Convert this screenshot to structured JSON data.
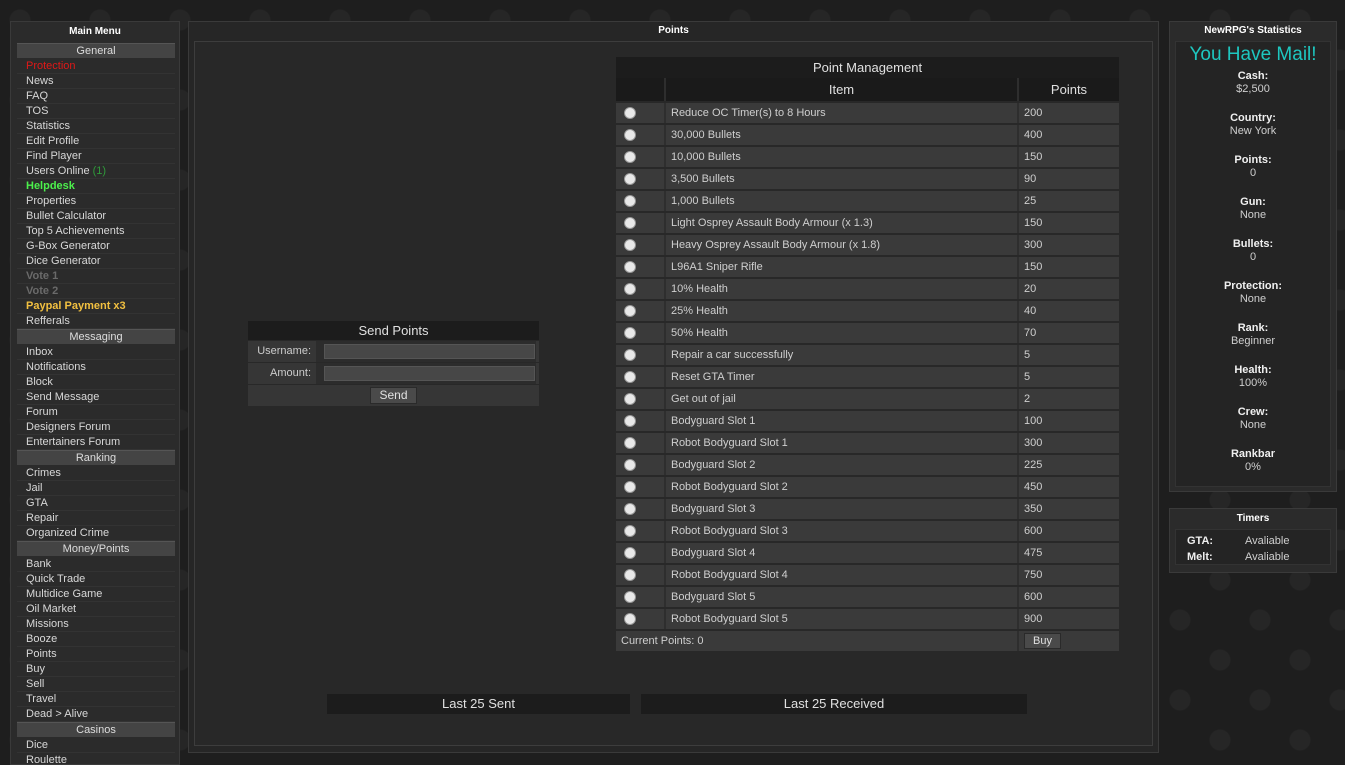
{
  "main_menu": {
    "title": "Main Menu",
    "sections": [
      {
        "name": "General",
        "items": [
          {
            "label": "Protection",
            "color": "#e01818",
            "bold": false
          },
          {
            "label": "News"
          },
          {
            "label": "FAQ"
          },
          {
            "label": "TOS"
          },
          {
            "label": "Statistics"
          },
          {
            "label": "Edit Profile"
          },
          {
            "label": "Find Player"
          },
          {
            "label": "Users Online",
            "count": "(1)"
          },
          {
            "label": "Helpdesk",
            "color": "#4cf04c",
            "bold": true
          },
          {
            "label": "Properties"
          },
          {
            "label": "Bullet Calculator"
          },
          {
            "label": "Top 5 Achievements"
          },
          {
            "label": "G-Box Generator"
          },
          {
            "label": "Dice Generator"
          },
          {
            "label": "Vote 1",
            "color": "#6a6a6a",
            "bold": true
          },
          {
            "label": "Vote 2",
            "color": "#6a6a6a",
            "bold": true
          },
          {
            "label": "Paypal Payment x3",
            "color": "#f2c040",
            "bold": true
          },
          {
            "label": "Refferals"
          }
        ]
      },
      {
        "name": "Messaging",
        "items": [
          {
            "label": "Inbox"
          },
          {
            "label": "Notifications"
          },
          {
            "label": "Block"
          },
          {
            "label": "Send Message"
          },
          {
            "label": "Forum"
          },
          {
            "label": "Designers Forum"
          },
          {
            "label": "Entertainers Forum"
          }
        ]
      },
      {
        "name": "Ranking",
        "items": [
          {
            "label": "Crimes"
          },
          {
            "label": "Jail"
          },
          {
            "label": "GTA"
          },
          {
            "label": "Repair"
          },
          {
            "label": "Organized Crime"
          }
        ]
      },
      {
        "name": "Money/Points",
        "items": [
          {
            "label": "Bank"
          },
          {
            "label": "Quick Trade"
          },
          {
            "label": "Multidice Game"
          },
          {
            "label": "Oil Market"
          },
          {
            "label": "Missions"
          },
          {
            "label": "Booze"
          },
          {
            "label": "Points"
          },
          {
            "label": "Buy"
          },
          {
            "label": "Sell"
          },
          {
            "label": "Travel"
          },
          {
            "label": "Dead > Alive"
          }
        ]
      },
      {
        "name": "Casinos",
        "items": [
          {
            "label": "Dice"
          },
          {
            "label": "Roulette"
          }
        ]
      }
    ]
  },
  "center": {
    "title": "Points",
    "send_points": {
      "title": "Send Points",
      "username_label": "Username:",
      "username_value": "",
      "amount_label": "Amount:",
      "amount_value": "",
      "send_label": "Send"
    },
    "point_management": {
      "title": "Point Management",
      "col_item": "Item",
      "col_points": "Points",
      "rows": [
        {
          "item": "Reduce OC Timer(s) to 8 Hours",
          "points": "200"
        },
        {
          "item": "30,000 Bullets",
          "points": "400"
        },
        {
          "item": "10,000 Bullets",
          "points": "150"
        },
        {
          "item": "3,500 Bullets",
          "points": "90"
        },
        {
          "item": "1,000 Bullets",
          "points": "25"
        },
        {
          "item": "Light Osprey Assault Body Armour (x 1.3)",
          "points": "150"
        },
        {
          "item": "Heavy Osprey Assault Body Armour (x 1.8)",
          "points": "300"
        },
        {
          "item": "L96A1 Sniper Rifle",
          "points": "150"
        },
        {
          "item": "10% Health",
          "points": "20"
        },
        {
          "item": "25% Health",
          "points": "40"
        },
        {
          "item": "50% Health",
          "points": "70"
        },
        {
          "item": "Repair a car successfully",
          "points": "5"
        },
        {
          "item": "Reset GTA Timer",
          "points": "5"
        },
        {
          "item": "Get out of jail",
          "points": "2"
        },
        {
          "item": "Bodyguard Slot 1",
          "points": "100"
        },
        {
          "item": "Robot Bodyguard Slot 1",
          "points": "300"
        },
        {
          "item": "Bodyguard Slot 2",
          "points": "225"
        },
        {
          "item": "Robot Bodyguard Slot 2",
          "points": "450"
        },
        {
          "item": "Bodyguard Slot 3",
          "points": "350"
        },
        {
          "item": "Robot Bodyguard Slot 3",
          "points": "600"
        },
        {
          "item": "Bodyguard Slot 4",
          "points": "475"
        },
        {
          "item": "Robot Bodyguard Slot 4",
          "points": "750"
        },
        {
          "item": "Bodyguard Slot 5",
          "points": "600"
        },
        {
          "item": "Robot Bodyguard Slot 5",
          "points": "900"
        }
      ],
      "current_points": "Current Points: 0",
      "buy_label": "Buy"
    },
    "last_sent": "Last 25 Sent",
    "last_received": "Last 25 Received"
  },
  "stats": {
    "title": "NewRPG's Statistics",
    "mail": "You Have Mail!",
    "items": [
      {
        "key": "Cash:",
        "value": "$2,500"
      },
      {
        "key": "Country:",
        "value": "New York"
      },
      {
        "key": "Points:",
        "value": "0"
      },
      {
        "key": "Gun:",
        "value": "None"
      },
      {
        "key": "Bullets:",
        "value": "0"
      },
      {
        "key": "Protection:",
        "value": "None"
      },
      {
        "key": "Rank:",
        "value": "Beginner"
      },
      {
        "key": "Health:",
        "value": "100%"
      },
      {
        "key": "Crew:",
        "value": "None"
      },
      {
        "key": "Rankbar",
        "value": "0%"
      }
    ]
  },
  "timers": {
    "title": "Timers",
    "rows": [
      {
        "key": "GTA:",
        "value": "Avaliable"
      },
      {
        "key": "Melt:",
        "value": "Avaliable"
      }
    ]
  }
}
